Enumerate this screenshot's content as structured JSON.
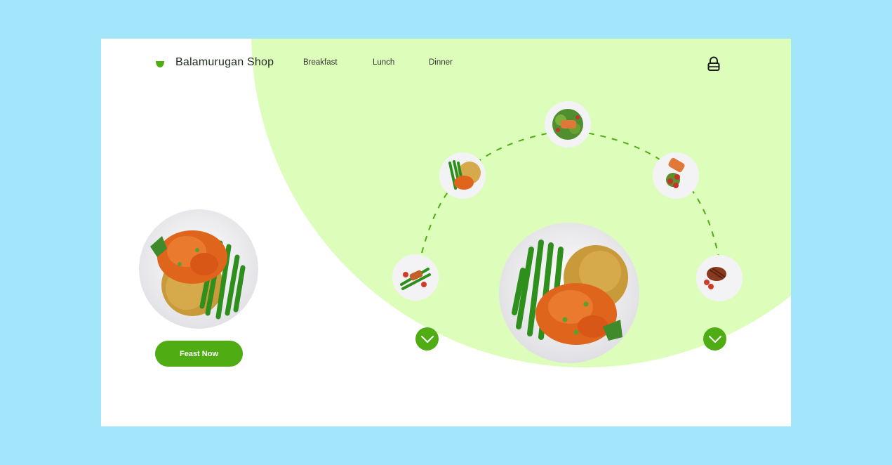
{
  "header": {
    "brand": "Balamurugan Shop",
    "nav": [
      "Breakfast",
      "Lunch",
      "Dinner"
    ]
  },
  "hero": {
    "cta_label": "Feast Now"
  },
  "icons": {
    "logo": "leaf-bowl-icon",
    "cart": "lock-icon",
    "prev": "chevron-down-icon",
    "next": "chevron-down-icon"
  },
  "colors": {
    "page_bg": "#a3e5fa",
    "card_bg": "#ffffff",
    "blob": "#ddfdbb",
    "accent": "#4fac13"
  }
}
